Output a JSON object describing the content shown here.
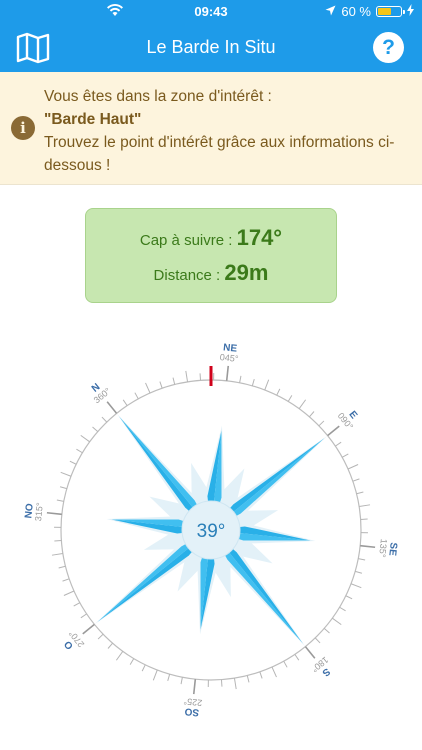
{
  "status_bar": {
    "time": "09:43",
    "battery_percent": "60 %",
    "battery_level": 0.6,
    "icons": [
      "wifi-icon",
      "location-arrow-icon",
      "battery-icon",
      "charging-bolt-icon"
    ]
  },
  "nav": {
    "title": "Le Barde In Situ",
    "map_icon": "map-icon",
    "help_label": "?"
  },
  "banner": {
    "icon_label": "i",
    "line1": "Vous êtes dans la zone d'intérêt :",
    "poi_name": "\"Barde Haut\"",
    "line3": "Trouvez le point d'intérêt grâce aux informations ci-dessous !"
  },
  "guidance": {
    "heading_label": "Cap à suivre :",
    "heading_value": "174°",
    "distance_label": "Distance :",
    "distance_value": "29m"
  },
  "compass": {
    "center_heading": "39°",
    "heading_degrees": 39,
    "markers": [
      {
        "dir": "N",
        "deg": "360°"
      },
      {
        "dir": "NE",
        "deg": "045°"
      },
      {
        "dir": "E",
        "deg": "090°"
      },
      {
        "dir": "SE",
        "deg": "135°"
      },
      {
        "dir": "S",
        "deg": "180°"
      },
      {
        "dir": "SO",
        "deg": "225°"
      },
      {
        "dir": "O",
        "deg": "270°"
      },
      {
        "dir": "NO",
        "deg": "315°"
      }
    ],
    "colors": {
      "accent": "#1e9be9",
      "rose_dark": "#29b0e8",
      "rose_light": "#e3f1f8",
      "indicator": "#d0021b"
    }
  }
}
